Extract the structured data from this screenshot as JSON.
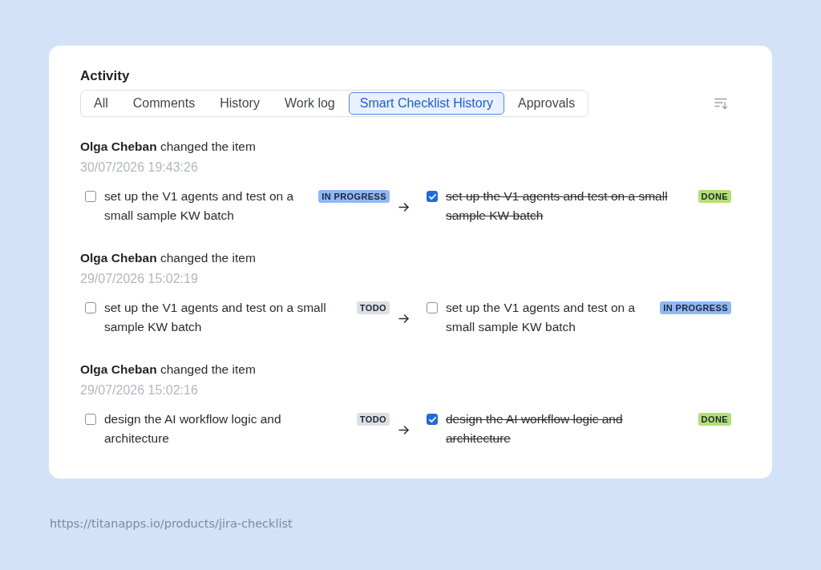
{
  "activity": {
    "title": "Activity",
    "tabs": [
      {
        "label": "All",
        "selected": false
      },
      {
        "label": "Comments",
        "selected": false
      },
      {
        "label": "History",
        "selected": false
      },
      {
        "label": "Work log",
        "selected": false
      },
      {
        "label": "Smart Checklist History",
        "selected": true
      },
      {
        "label": "Approvals",
        "selected": false
      }
    ],
    "entries": [
      {
        "headline": "**Olga Cheban** changed the item",
        "timestamp": "30/07/2026 19:43:26",
        "before": {
          "text": "set up the V1 agents and test on a small sample KW batch",
          "checked": false,
          "status": {
            "label": "IN PROGRESS",
            "color": "#8fb8f6"
          }
        },
        "after": {
          "text": "set up the V1 agents and test on a small sample KW batch",
          "checked": true,
          "status": {
            "label": "DONE",
            "color": "#b3df72"
          }
        }
      },
      {
        "headline": "**Olga Cheban** changed the item",
        "timestamp": "29/07/2026 15:02:19",
        "before": {
          "text": "set up the V1 agents and test on a small sample KW batch",
          "checked": false,
          "status": {
            "label": "TODO",
            "color": "#dcdfe4"
          }
        },
        "after": {
          "text": "set up the V1 agents and test on a small sample KW batch",
          "checked": false,
          "status": {
            "label": "IN PROGRESS",
            "color": "#8fb8f6"
          }
        }
      },
      {
        "headline": "**Olga Cheban** changed the item",
        "timestamp": "29/07/2026 15:02:16",
        "before": {
          "text": "design the AI workflow logic and architecture",
          "checked": false,
          "status": {
            "label": "TODO",
            "color": "#dcdfe4"
          }
        },
        "after": {
          "text": "design the AI workflow logic and architecture",
          "checked": true,
          "status": {
            "label": "DONE",
            "color": "#b3df72"
          }
        }
      }
    ]
  },
  "source_url": "https://titanapps.io/products/jira-checklist"
}
